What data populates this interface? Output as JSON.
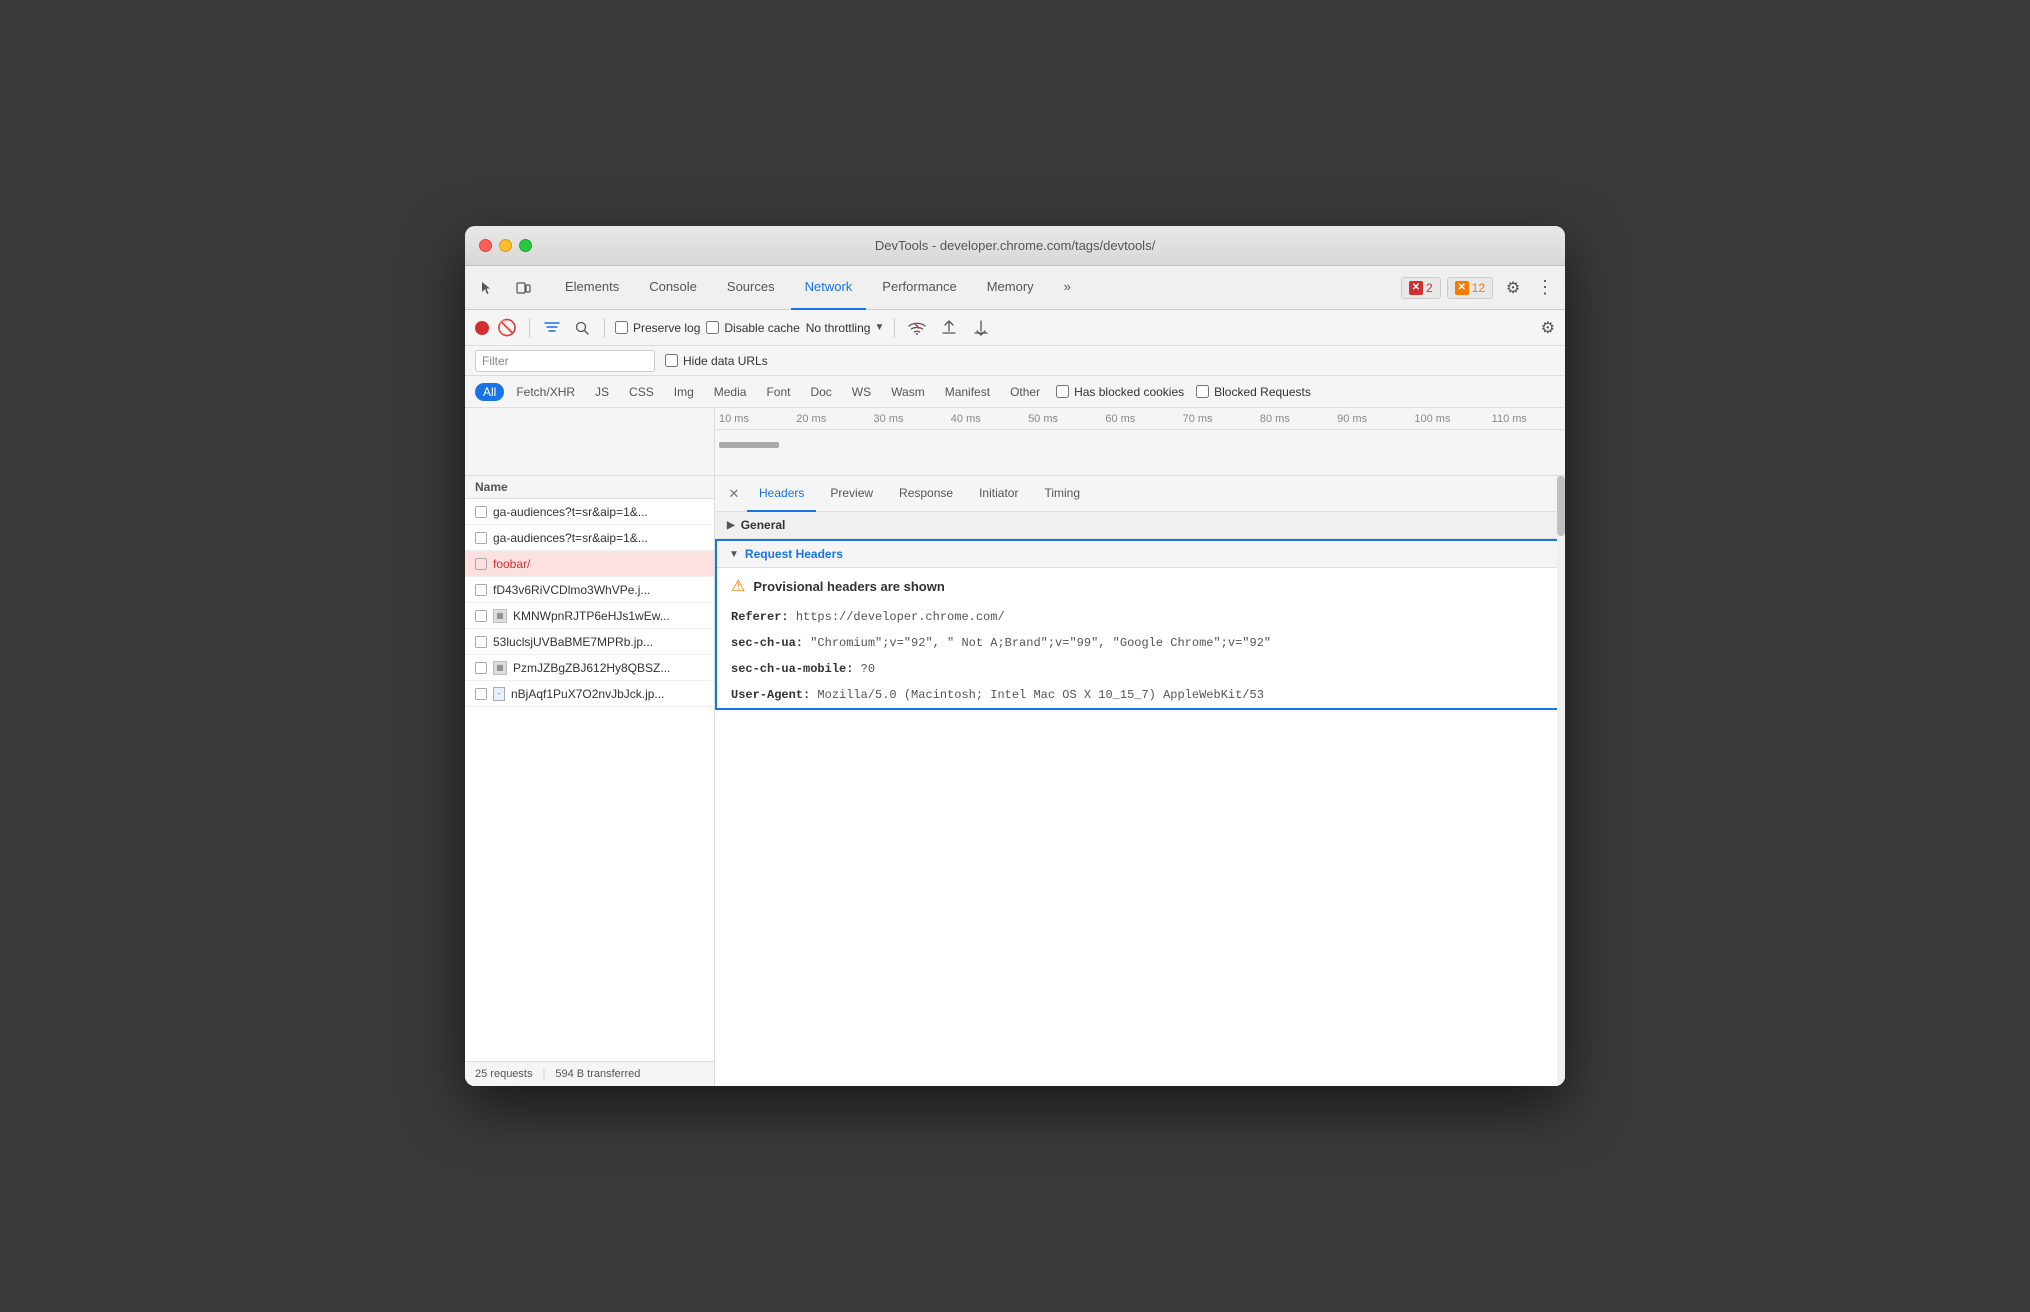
{
  "titlebar": {
    "title": "DevTools - developer.chrome.com/tags/devtools/"
  },
  "tabs": {
    "items": [
      {
        "label": "Elements",
        "active": false
      },
      {
        "label": "Console",
        "active": false
      },
      {
        "label": "Sources",
        "active": false
      },
      {
        "label": "Network",
        "active": true
      },
      {
        "label": "Performance",
        "active": false
      },
      {
        "label": "Memory",
        "active": false
      }
    ],
    "more_label": "»",
    "error_count": "2",
    "warn_count": "12"
  },
  "toolbar": {
    "preserve_log": "Preserve log",
    "disable_cache": "Disable cache",
    "no_throttling": "No throttling"
  },
  "filter": {
    "placeholder": "Filter",
    "hide_data_urls": "Hide data URLs"
  },
  "type_filters": {
    "items": [
      "All",
      "Fetch/XHR",
      "JS",
      "CSS",
      "Img",
      "Media",
      "Font",
      "Doc",
      "WS",
      "Wasm",
      "Manifest",
      "Other"
    ],
    "active": "All",
    "has_blocked": "Has blocked cookies",
    "blocked_requests": "Blocked Requests"
  },
  "timeline": {
    "labels": [
      "10 ms",
      "20 ms",
      "30 ms",
      "40 ms",
      "50 ms",
      "60 ms",
      "70 ms",
      "80 ms",
      "90 ms",
      "100 ms",
      "110 ms"
    ]
  },
  "request_list": {
    "header": "Name",
    "items": [
      {
        "name": "ga-audiences?t=sr&aip=1&...",
        "type": "checkbox",
        "selected": false,
        "error": false
      },
      {
        "name": "ga-audiences?t=sr&aip=1&...",
        "type": "checkbox",
        "selected": false,
        "error": false
      },
      {
        "name": "foobar/",
        "type": "checkbox",
        "selected": true,
        "error": true
      },
      {
        "name": "fD43v6RiVCDlmo3WhVPe.j...",
        "type": "checkbox",
        "selected": false,
        "error": false
      },
      {
        "name": "KMNWpnRJTP6eHJs1wEw...",
        "type": "img",
        "selected": false,
        "error": false
      },
      {
        "name": "53luclsjUVBaBME7MPRb.jp...",
        "type": "checkbox",
        "selected": false,
        "error": false
      },
      {
        "name": "PzmJZBgZBJ612Hy8QBSZ...",
        "type": "img",
        "selected": false,
        "error": false
      },
      {
        "name": "nBjAqf1PuX7O2nvJbJck.jp...",
        "type": "doc",
        "selected": false,
        "error": false
      }
    ],
    "footer": {
      "requests": "25 requests",
      "transferred": "594 B transferred"
    }
  },
  "details": {
    "tabs": [
      "Headers",
      "Preview",
      "Response",
      "Initiator",
      "Timing"
    ],
    "active_tab": "Headers",
    "sections": {
      "general": {
        "label": "General",
        "expanded": false
      },
      "request_headers": {
        "label": "Request Headers",
        "warning": "Provisional headers are shown",
        "headers": [
          {
            "key": "Referer:",
            "value": "https://developer.chrome.com/"
          },
          {
            "key": "sec-ch-ua:",
            "value": "\"Chromium\";v=\"92\", \" Not A;Brand\";v=\"99\", \"Google Chrome\";v=\"92\""
          },
          {
            "key": "sec-ch-ua-mobile:",
            "value": "?0"
          },
          {
            "key": "User-Agent:",
            "value": "Mozilla/5.0 (Macintosh; Intel Mac OS X 10_15_7) AppleWebKit/53"
          }
        ]
      }
    }
  }
}
